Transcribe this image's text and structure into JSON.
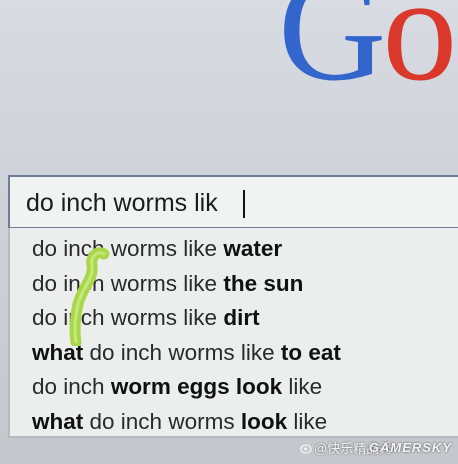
{
  "logo": {
    "letters": [
      {
        "char": "G",
        "color": "#3366cc"
      },
      {
        "char": "o",
        "color": "#d9382b"
      }
    ]
  },
  "search": {
    "query": "do inch worms lik"
  },
  "suggestions": [
    {
      "parts": [
        {
          "text": "do inch worms like ",
          "bold": false
        },
        {
          "text": "water",
          "bold": true
        }
      ]
    },
    {
      "parts": [
        {
          "text": "do inch worms like ",
          "bold": false
        },
        {
          "text": "the sun",
          "bold": true
        }
      ]
    },
    {
      "parts": [
        {
          "text": "do inch worms like ",
          "bold": false
        },
        {
          "text": "dirt",
          "bold": true
        }
      ]
    },
    {
      "parts": [
        {
          "text": "what",
          "bold": true
        },
        {
          "text": " do inch worms like ",
          "bold": false
        },
        {
          "text": "to eat",
          "bold": true
        }
      ]
    },
    {
      "parts": [
        {
          "text": "do inch ",
          "bold": false
        },
        {
          "text": "worm eggs look",
          "bold": true
        },
        {
          "text": " like",
          "bold": false
        }
      ]
    },
    {
      "parts": [
        {
          "text": "what",
          "bold": true
        },
        {
          "text": " do inch worms ",
          "bold": false
        },
        {
          "text": "look",
          "bold": true
        },
        {
          "text": " like",
          "bold": false
        }
      ]
    }
  ],
  "watermarks": {
    "weibo": "@快乐精品秀",
    "site": "GAMERSKY"
  },
  "colors": {
    "search_border": "#6e7b9c",
    "inchworm": "#a8d84a"
  }
}
